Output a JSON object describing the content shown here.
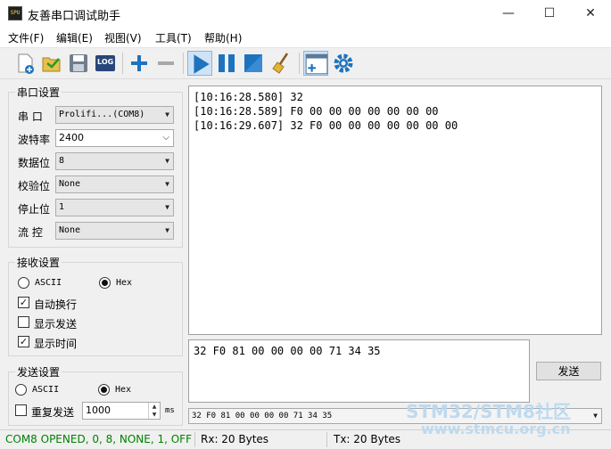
{
  "window": {
    "title": "友善串口调试助手",
    "app_icon_text": "SPU",
    "minimize": "—",
    "maximize": "☐",
    "close": "✕"
  },
  "menu": [
    "文件(F)",
    "编辑(E)",
    "视图(V)",
    "工具(T)",
    "帮助(H)"
  ],
  "toolbar": {
    "log_label": "LOG"
  },
  "serial_settings": {
    "title": "串口设置",
    "port_label": "串  口",
    "port_value": "Prolifi...(COM8)",
    "baud_label": "波特率",
    "baud_value": "2400",
    "databits_label": "数据位",
    "databits_value": "8",
    "parity_label": "校验位",
    "parity_value": "None",
    "stopbits_label": "停止位",
    "stopbits_value": "1",
    "flow_label": "流  控",
    "flow_value": "None"
  },
  "receive_settings": {
    "title": "接收设置",
    "ascii_label": "ASCII",
    "hex_label": "Hex",
    "mode": "Hex",
    "auto_newline_label": "自动换行",
    "auto_newline": true,
    "show_send_label": "显示发送",
    "show_send": false,
    "show_time_label": "显示时间",
    "show_time": true
  },
  "send_settings": {
    "title": "发送设置",
    "ascii_label": "ASCII",
    "hex_label": "Hex",
    "mode": "Hex",
    "repeat_label": "重复发送",
    "repeat": false,
    "interval": "1000",
    "interval_unit": "ms"
  },
  "receive_log": [
    "[10:16:28.580] 32",
    "[10:16:28.589] F0 00 00 00 00 00 00 00",
    "[10:16:29.607] 32 F0 00 00 00 00 00 00 00"
  ],
  "send_text": "32 F0 81 00 00 00 00 71 34 35",
  "send_button": "发送",
  "send_history": "32 F0 81 00 00 00 00 71 34 35",
  "status": {
    "port_state": "COM8 OPENED, 0, 8, NONE, 1, OFF",
    "rx": "Rx: 20 Bytes",
    "tx": "Tx: 20 Bytes"
  },
  "watermark": {
    "line1": "STM32/STM8社区",
    "line2": "www.stmcu.org.cn"
  },
  "colors": {
    "port_state": "#008000",
    "accent_blue": "#1e73be"
  }
}
